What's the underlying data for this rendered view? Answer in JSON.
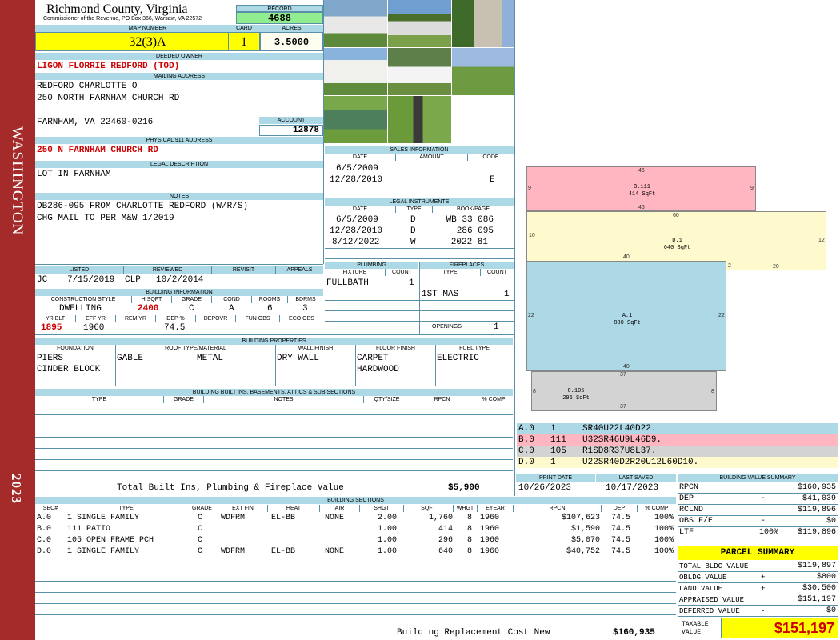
{
  "sidebar": {
    "district": "WASHINGTON",
    "year": "2023"
  },
  "header": {
    "county": "Richmond County, Virginia",
    "commissioner": "Commissioner of the Revenue, PO Box 366, Warsaw, VA 22572",
    "record_label": "RECORD",
    "record": "4688",
    "map_label": "MAP NUMBER",
    "map_number": "32(3)A",
    "card_label": "CARD",
    "card": "1",
    "acres_label": "ACRES",
    "acres": "3.5000"
  },
  "owner": {
    "deeded_label": "DEEDED OWNER",
    "deeded_owner": "LIGON FLORRIE REDFORD (TOD)",
    "mailing_label": "MAILING ADDRESS",
    "mail_line1": "REDFORD CHARLOTTE O",
    "mail_line2": "250 NORTH FARNHAM CHURCH RD",
    "mail_line3": "FARNHAM, VA 22460-0216",
    "account_label": "ACCOUNT",
    "account": "12878",
    "physical_label": "PHYSICAL 911 ADDRESS",
    "physical": "250 N FARNHAM CHURCH RD"
  },
  "legal": {
    "label": "LEGAL DESCRIPTION",
    "text": "LOT IN FARNHAM"
  },
  "notes": {
    "label": "NOTES",
    "line1": "DB286-095 FROM CHARLOTTE REDFORD (W/R/S)",
    "line2": "CHG MAIL TO PER M&W 1/2019"
  },
  "sales": {
    "label": "SALES INFORMATION",
    "cols": [
      "DATE",
      "AMOUNT",
      "CODE"
    ],
    "rows": [
      {
        "date": "6/5/2009",
        "amount": "",
        "code": ""
      },
      {
        "date": "12/28/2010",
        "amount": "",
        "code": "E"
      }
    ]
  },
  "legal_instruments": {
    "label": "LEGAL INSTRUMENTS",
    "cols": [
      "DATE",
      "TYPE",
      "BOOK/PAGE"
    ],
    "rows": [
      {
        "date": "6/5/2009",
        "type": "D",
        "book": "WB 33 086"
      },
      {
        "date": "12/28/2010",
        "type": "D",
        "book": "286 095"
      },
      {
        "date": "8/12/2022",
        "type": "W",
        "book": "2022 81"
      }
    ]
  },
  "listing": {
    "cols": [
      "LISTED",
      "REVIEWED",
      "REVISIT",
      "APPEALS"
    ],
    "listed_by": "JC",
    "listed_date": "7/15/2019",
    "reviewed_by": "CLP",
    "reviewed_date": "10/2/2014",
    "revisit": "",
    "appeals": ""
  },
  "building_info": {
    "label": "BUILDING INFORMATION",
    "cols": [
      "CONSTRUCTION STYLE",
      "H SQFT",
      "GRADE",
      "COND",
      "ROOMS",
      "BDRMS"
    ],
    "style": "DWELLING",
    "hsqft": "2400",
    "grade": "C",
    "cond": "A",
    "rooms": "6",
    "bdrms": "3",
    "cols2": [
      "YR BLT",
      "EFF YR",
      "REM YR",
      "DEP %",
      "DEPOVR",
      "FUN OBS",
      "ECO OBS"
    ],
    "yr_blt": "1895",
    "eff_yr": "1960",
    "rem_yr": "",
    "dep": "74.5",
    "depovr": "",
    "fun_obs": "",
    "eco_obs": ""
  },
  "plumbing": {
    "label": "PLUMBING",
    "cols": [
      "FIXTURE",
      "COUNT"
    ],
    "fixture": "FULLBATH",
    "count": "1"
  },
  "fireplaces": {
    "label": "FIREPLACES",
    "cols": [
      "TYPE",
      "COUNT"
    ],
    "type": "1ST MAS",
    "count": "1",
    "openings_label": "OPENINGS",
    "openings": "1"
  },
  "properties": {
    "label": "BUILDING PROPERTIES",
    "cols": [
      "FOUNDATION",
      "ROOF TYPE/MATERIAL",
      "WALL FINISH",
      "FLOOR FINISH",
      "FUEL TYPE"
    ],
    "foundation1": "PIERS",
    "foundation2": "CINDER BLOCK",
    "roof_type": "GABLE",
    "roof_material": "METAL",
    "wall": "DRY WALL",
    "floor1": "CARPET",
    "floor2": "HARDWOOD",
    "fuel": "ELECTRIC"
  },
  "builtins": {
    "label": "BUILDING BUILT INS, BASEMENTS, ATTICS & SUB SECTIONS",
    "cols": [
      "TYPE",
      "GRADE",
      "NOTES",
      "QTY/SIZE",
      "RPCN",
      "% COMP"
    ],
    "total_label": "Total Built Ins, Plumbing & Fireplace Value",
    "total": "$5,900"
  },
  "dates": {
    "print_label": "PRINT DATE",
    "print_date": "10/26/2023",
    "saved_label": "LAST SAVED",
    "last_saved": "10/17/2023"
  },
  "sections": {
    "label": "BUILDING SECTIONS",
    "cols": [
      "SEC#",
      "TYPE",
      "GRADE",
      "EXT FIN",
      "HEAT",
      "AIR",
      "SHGT",
      "SQFT",
      "WHGT",
      "EYEAR",
      "RPCN",
      "DEP",
      "% COMP"
    ],
    "rows": [
      {
        "sec": "A.0",
        "type": "1 SINGLE FAMILY",
        "grade": "C",
        "ext": "WDFRM",
        "heat": "EL-BB",
        "air": "NONE",
        "shgt": "2.00",
        "sqft": "1,760",
        "whgt": "8",
        "eyear": "1960",
        "rpcn": "$107,623",
        "dep": "74.5",
        "comp": "100%"
      },
      {
        "sec": "B.0",
        "type": "111 PATIO",
        "grade": "C",
        "ext": "",
        "heat": "",
        "air": "",
        "shgt": "1.00",
        "sqft": "414",
        "whgt": "8",
        "eyear": "1960",
        "rpcn": "$1,590",
        "dep": "74.5",
        "comp": "100%"
      },
      {
        "sec": "C.0",
        "type": "105 OPEN FRAME PCH",
        "grade": "C",
        "ext": "",
        "heat": "",
        "air": "",
        "shgt": "1.00",
        "sqft": "296",
        "whgt": "8",
        "eyear": "1960",
        "rpcn": "$5,070",
        "dep": "74.5",
        "comp": "100%"
      },
      {
        "sec": "D.0",
        "type": "1 SINGLE FAMILY",
        "grade": "C",
        "ext": "WDFRM",
        "heat": "EL-BB",
        "air": "NONE",
        "shgt": "1.00",
        "sqft": "640",
        "whgt": "8",
        "eyear": "1960",
        "rpcn": "$40,752",
        "dep": "74.5",
        "comp": "100%"
      }
    ],
    "replacement_label": "Building Replacement Cost New",
    "replacement": "$160,935"
  },
  "sketch": {
    "areas": [
      {
        "id": "B.111",
        "sqft": "414 SqFt",
        "color": "#ffb6c1",
        "top": "46",
        "bottom": "46",
        "left": "9",
        "right": "9"
      },
      {
        "id": "D.1",
        "sqft": "640 SqFt",
        "color": "#fffacd",
        "top": "60",
        "left": "10",
        "right": "12",
        "b1": "40",
        "b2": "2",
        "b3": "20"
      },
      {
        "id": "A.1",
        "sqft": "880 SqFt",
        "color": "#add8e6",
        "left": "22",
        "right": "22",
        "bottom": "40"
      },
      {
        "id": "C.105",
        "sqft": "296 SqFt",
        "color": "#d3d3d3",
        "top": "37",
        "bottom": "37",
        "left": "8",
        "right": "8"
      }
    ],
    "segments": [
      {
        "sec": "A.0",
        "code": "1",
        "path": "SR40U22L40D22.",
        "color": "#add8e6"
      },
      {
        "sec": "B.0",
        "code": "111",
        "path": "U32SR46U9L46D9.",
        "color": "#ffb6c1"
      },
      {
        "sec": "C.0",
        "code": "105",
        "path": "R1SD8R37U8L37.",
        "color": "#d3d3d3"
      },
      {
        "sec": "D.0",
        "code": "1",
        "path": "U22SR40D2R20U12L60D10.",
        "color": "#fffacd"
      }
    ]
  },
  "value_summary": {
    "label": "BUILDING VALUE SUMMARY",
    "rows": [
      {
        "label": "RPCN",
        "sign": "",
        "pct": "",
        "value": "$160,935"
      },
      {
        "label": "DEP",
        "sign": "-",
        "pct": "",
        "value": "$41,039"
      },
      {
        "label": "RCLND",
        "sign": "",
        "pct": "",
        "value": "$119,896"
      },
      {
        "label": "OBS F/E",
        "sign": "-",
        "pct": "",
        "value": "$0"
      },
      {
        "label": "LTF",
        "sign": "",
        "pct": "100%",
        "value": "$119,896"
      }
    ]
  },
  "parcel": {
    "label": "PARCEL SUMMARY",
    "rows": [
      {
        "label": "TOTAL BLDG VALUE",
        "sign": "",
        "value": "$119,897"
      },
      {
        "label": "OBLDG VALUE",
        "sign": "+",
        "value": "$800"
      },
      {
        "label": "LAND VALUE",
        "sign": "+",
        "value": "$30,500"
      },
      {
        "label": "APPRAISED VALUE",
        "sign": "",
        "value": "$151,197"
      },
      {
        "label": "DEFERRED VALUE",
        "sign": "-",
        "value": "$0"
      }
    ],
    "taxable_label": "TAXABLE VALUE",
    "taxable": "$151,197"
  },
  "colors": {
    "sidebar": "#a52a2a",
    "header_blue": "#add8e6",
    "yellow": "#ffff00",
    "green": "#90ee90",
    "red_text": "#cc0000"
  }
}
